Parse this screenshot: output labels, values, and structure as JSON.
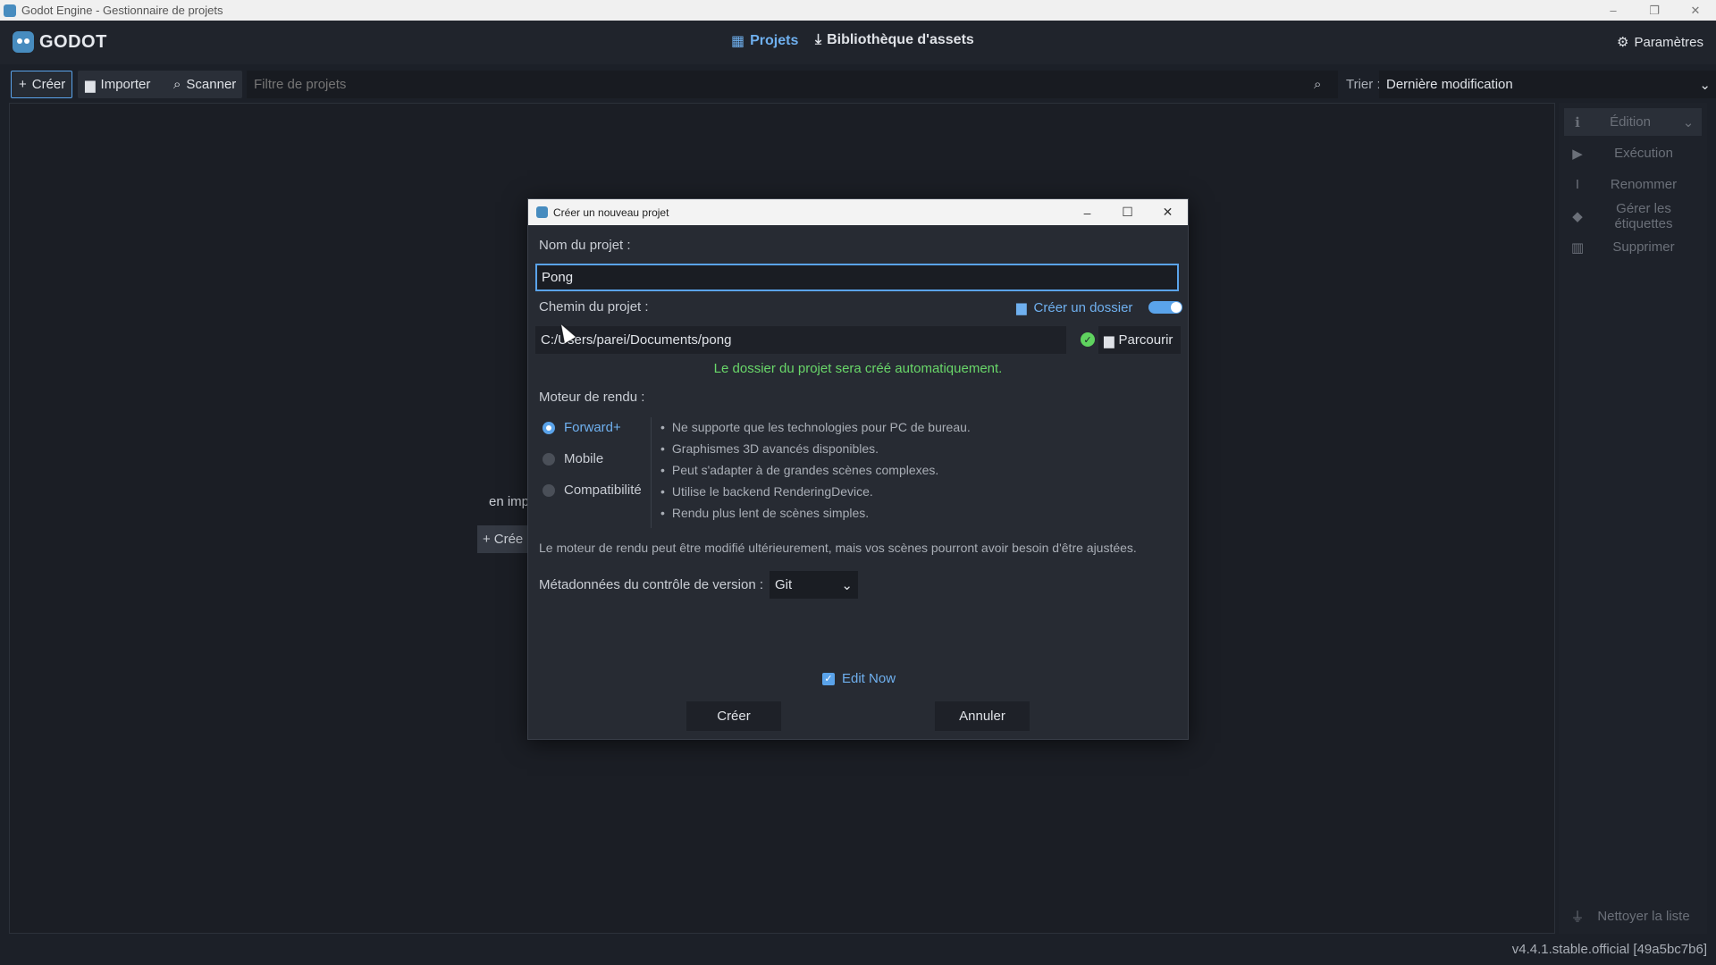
{
  "window": {
    "title": "Godot Engine - Gestionnaire de projets",
    "minimize": "–",
    "restore": "❐",
    "close": "✕"
  },
  "header": {
    "logo_text": "GODOT",
    "tabs": [
      {
        "label": "Projets",
        "icon": "list-icon",
        "active": true
      },
      {
        "label": "Bibliothèque d'assets",
        "icon": "download-icon",
        "active": false
      }
    ],
    "settings_label": "Paramètres"
  },
  "toolbar": {
    "create_label": "Créer",
    "import_label": "Importer",
    "scan_label": "Scanner",
    "filter_placeholder": "Filtre de projets",
    "sort_label": "Trier :",
    "sort_value": "Dernière modification"
  },
  "background": {
    "partial_text": "en imp",
    "partial_create": "Crée"
  },
  "side_panel": {
    "edit": "Édition",
    "run": "Exécution",
    "rename": "Renommer",
    "tags": "Gérer les étiquettes",
    "delete": "Supprimer",
    "clean": "Nettoyer la liste"
  },
  "version": "v4.4.1.stable.official [49a5bc7b6]",
  "dialog": {
    "title": "Créer un nouveau projet",
    "name_label": "Nom du projet :",
    "name_value": "Pong",
    "path_label": "Chemin du projet :",
    "create_folder_label": "Créer un dossier",
    "create_folder_on": true,
    "path_value": "C:/Users/parei/Documents/pong",
    "browse_label": "Parcourir",
    "path_status": "Le dossier du projet sera créé automatiquement.",
    "renderer_label": "Moteur de rendu :",
    "renderers": [
      {
        "label": "Forward+",
        "selected": true
      },
      {
        "label": "Mobile",
        "selected": false
      },
      {
        "label": "Compatibilité",
        "selected": false
      }
    ],
    "features": [
      "Ne supporte que les technologies pour PC de bureau.",
      "Graphismes 3D avancés disponibles.",
      "Peut s'adapter à de grandes scènes complexes.",
      "Utilise le backend RenderingDevice.",
      "Rendu plus lent de scènes simples."
    ],
    "renderer_note": "Le moteur de rendu peut être modifié ultérieurement, mais vos scènes pourront avoir besoin d'être ajustées.",
    "vcs_label": "Métadonnées du contrôle de version :",
    "vcs_value": "Git",
    "edit_now_label": "Edit Now",
    "edit_now_checked": true,
    "create_button": "Créer",
    "cancel_button": "Annuler"
  },
  "colors": {
    "accent": "#5aa3ea",
    "success": "#69d769",
    "background": "#1c2028"
  }
}
